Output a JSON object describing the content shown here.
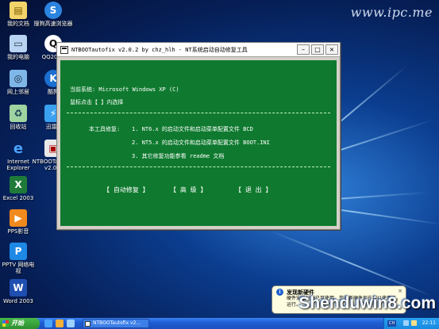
{
  "desktop": {
    "watermark_top": "www.ipc.me",
    "watermark_bottom": "Shenduwin8.com",
    "icons": [
      {
        "label": "我的文档",
        "name": "my-documents-icon"
      },
      {
        "label": "搜狗高速浏览器",
        "name": "sogou-browser-icon"
      },
      {
        "label": "我的电脑",
        "name": "my-computer-icon"
      },
      {
        "label": "QQ2011",
        "name": "qq-icon"
      },
      {
        "label": "网上邻居",
        "name": "network-places-icon"
      },
      {
        "label": "酷狗",
        "name": "kugou-icon"
      },
      {
        "label": "回收站",
        "name": "recycle-bin-icon"
      },
      {
        "label": "迅雷7",
        "name": "thunder-icon"
      },
      {
        "label": "Internet",
        "label2": "Explorer",
        "name": "internet-explorer-icon"
      },
      {
        "label": "NTBOOTautofix",
        "label2": "v2.0.2",
        "name": "ntbootautofix-icon"
      },
      {
        "label": "Excel 2003",
        "name": "excel-icon"
      },
      {
        "label": "PPS影音",
        "name": "pps-icon"
      },
      {
        "label": "PPTV 网络电",
        "label2": "视",
        "name": "pptv-icon"
      },
      {
        "label": "Word 2003",
        "name": "word-icon"
      }
    ]
  },
  "window": {
    "title": "NTBOOTautofix v2.0.2 by chz_hlh - NT系统启动自动修复工具",
    "min_label": "–",
    "max_label": "□",
    "close_label": "×",
    "console": {
      "current_system": "当前系统: Microsoft Windows XP  (C)",
      "click_hint": "鼠标点击【 】内选择",
      "intro": "本工具修复:",
      "item1": "1. NT6.x 的启动文件和启动菜单配置文件 BCD",
      "item2": "2. NT5.x 的启动文件和启动菜单配置文件 BOOT.INI",
      "item3": "3. 其它修复功能参看 readme 文档",
      "auto_repair": "【 自动修复 】",
      "advanced": "【  高  级  】",
      "exit": "【  退  出  】"
    }
  },
  "balloon": {
    "title": "发现新硬件",
    "text": "硬件安装好并已可使用。您的新硬件现在可以使用了。  运行。",
    "close": "×"
  },
  "taskbar": {
    "start_label": "开始",
    "task_label": "NTBOOTautofix v2...",
    "lang": "CH",
    "clock": "22:11"
  },
  "colors": {
    "console_bg": "#0f7a2f",
    "taskbar": "#1f5ed6",
    "start": "#2e8f2f"
  }
}
